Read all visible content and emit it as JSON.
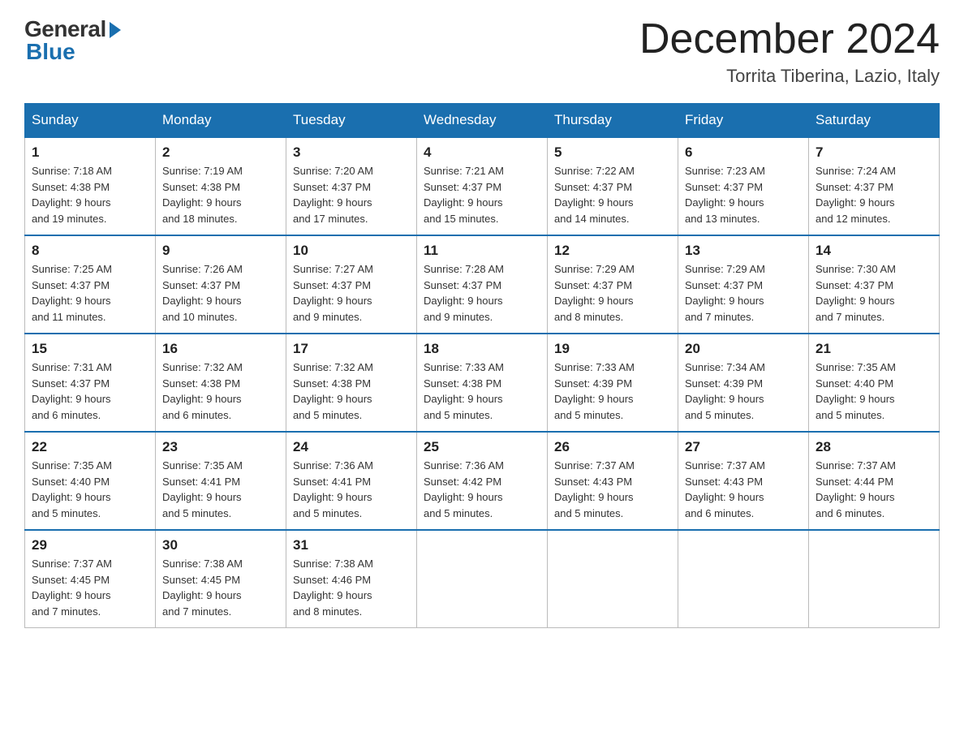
{
  "logo": {
    "general": "General",
    "blue": "Blue"
  },
  "title": "December 2024",
  "location": "Torrita Tiberina, Lazio, Italy",
  "days_header": [
    "Sunday",
    "Monday",
    "Tuesday",
    "Wednesday",
    "Thursday",
    "Friday",
    "Saturday"
  ],
  "weeks": [
    [
      {
        "day": "1",
        "sunrise": "7:18 AM",
        "sunset": "4:38 PM",
        "daylight": "9 hours and 19 minutes."
      },
      {
        "day": "2",
        "sunrise": "7:19 AM",
        "sunset": "4:38 PM",
        "daylight": "9 hours and 18 minutes."
      },
      {
        "day": "3",
        "sunrise": "7:20 AM",
        "sunset": "4:37 PM",
        "daylight": "9 hours and 17 minutes."
      },
      {
        "day": "4",
        "sunrise": "7:21 AM",
        "sunset": "4:37 PM",
        "daylight": "9 hours and 15 minutes."
      },
      {
        "day": "5",
        "sunrise": "7:22 AM",
        "sunset": "4:37 PM",
        "daylight": "9 hours and 14 minutes."
      },
      {
        "day": "6",
        "sunrise": "7:23 AM",
        "sunset": "4:37 PM",
        "daylight": "9 hours and 13 minutes."
      },
      {
        "day": "7",
        "sunrise": "7:24 AM",
        "sunset": "4:37 PM",
        "daylight": "9 hours and 12 minutes."
      }
    ],
    [
      {
        "day": "8",
        "sunrise": "7:25 AM",
        "sunset": "4:37 PM",
        "daylight": "9 hours and 11 minutes."
      },
      {
        "day": "9",
        "sunrise": "7:26 AM",
        "sunset": "4:37 PM",
        "daylight": "9 hours and 10 minutes."
      },
      {
        "day": "10",
        "sunrise": "7:27 AM",
        "sunset": "4:37 PM",
        "daylight": "9 hours and 9 minutes."
      },
      {
        "day": "11",
        "sunrise": "7:28 AM",
        "sunset": "4:37 PM",
        "daylight": "9 hours and 9 minutes."
      },
      {
        "day": "12",
        "sunrise": "7:29 AM",
        "sunset": "4:37 PM",
        "daylight": "9 hours and 8 minutes."
      },
      {
        "day": "13",
        "sunrise": "7:29 AM",
        "sunset": "4:37 PM",
        "daylight": "9 hours and 7 minutes."
      },
      {
        "day": "14",
        "sunrise": "7:30 AM",
        "sunset": "4:37 PM",
        "daylight": "9 hours and 7 minutes."
      }
    ],
    [
      {
        "day": "15",
        "sunrise": "7:31 AM",
        "sunset": "4:37 PM",
        "daylight": "9 hours and 6 minutes."
      },
      {
        "day": "16",
        "sunrise": "7:32 AM",
        "sunset": "4:38 PM",
        "daylight": "9 hours and 6 minutes."
      },
      {
        "day": "17",
        "sunrise": "7:32 AM",
        "sunset": "4:38 PM",
        "daylight": "9 hours and 5 minutes."
      },
      {
        "day": "18",
        "sunrise": "7:33 AM",
        "sunset": "4:38 PM",
        "daylight": "9 hours and 5 minutes."
      },
      {
        "day": "19",
        "sunrise": "7:33 AM",
        "sunset": "4:39 PM",
        "daylight": "9 hours and 5 minutes."
      },
      {
        "day": "20",
        "sunrise": "7:34 AM",
        "sunset": "4:39 PM",
        "daylight": "9 hours and 5 minutes."
      },
      {
        "day": "21",
        "sunrise": "7:35 AM",
        "sunset": "4:40 PM",
        "daylight": "9 hours and 5 minutes."
      }
    ],
    [
      {
        "day": "22",
        "sunrise": "7:35 AM",
        "sunset": "4:40 PM",
        "daylight": "9 hours and 5 minutes."
      },
      {
        "day": "23",
        "sunrise": "7:35 AM",
        "sunset": "4:41 PM",
        "daylight": "9 hours and 5 minutes."
      },
      {
        "day": "24",
        "sunrise": "7:36 AM",
        "sunset": "4:41 PM",
        "daylight": "9 hours and 5 minutes."
      },
      {
        "day": "25",
        "sunrise": "7:36 AM",
        "sunset": "4:42 PM",
        "daylight": "9 hours and 5 minutes."
      },
      {
        "day": "26",
        "sunrise": "7:37 AM",
        "sunset": "4:43 PM",
        "daylight": "9 hours and 5 minutes."
      },
      {
        "day": "27",
        "sunrise": "7:37 AM",
        "sunset": "4:43 PM",
        "daylight": "9 hours and 6 minutes."
      },
      {
        "day": "28",
        "sunrise": "7:37 AM",
        "sunset": "4:44 PM",
        "daylight": "9 hours and 6 minutes."
      }
    ],
    [
      {
        "day": "29",
        "sunrise": "7:37 AM",
        "sunset": "4:45 PM",
        "daylight": "9 hours and 7 minutes."
      },
      {
        "day": "30",
        "sunrise": "7:38 AM",
        "sunset": "4:45 PM",
        "daylight": "9 hours and 7 minutes."
      },
      {
        "day": "31",
        "sunrise": "7:38 AM",
        "sunset": "4:46 PM",
        "daylight": "9 hours and 8 minutes."
      },
      null,
      null,
      null,
      null
    ]
  ],
  "labels": {
    "sunrise": "Sunrise:",
    "sunset": "Sunset:",
    "daylight": "Daylight:"
  }
}
